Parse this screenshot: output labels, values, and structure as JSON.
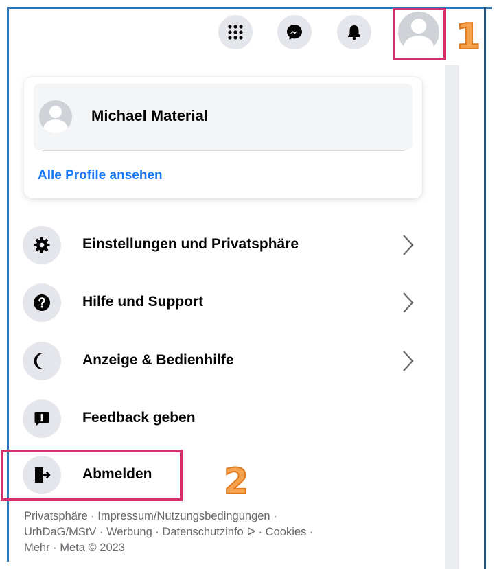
{
  "topbar": {
    "buttons": [
      {
        "icon": "grid-menu-icon"
      },
      {
        "icon": "messenger-icon"
      },
      {
        "icon": "notifications-bell-icon"
      },
      {
        "icon": "account-avatar-icon"
      }
    ]
  },
  "annotations": {
    "step1": "1",
    "step2": "2",
    "highlight_color": "#d62f6e",
    "number_color": "#f4a24d"
  },
  "profile_card": {
    "name": "Michael Material",
    "see_all_profiles": "Alle Profile ansehen"
  },
  "menu": {
    "items": [
      {
        "label": "Einstellungen und Privatsphäre",
        "icon": "gear-icon",
        "has_chevron": true
      },
      {
        "label": "Hilfe und Support",
        "icon": "question-icon",
        "has_chevron": true
      },
      {
        "label": "Anzeige & Bedienhilfe",
        "icon": "moon-icon",
        "has_chevron": true
      },
      {
        "label": "Feedback geben",
        "icon": "feedback-icon",
        "has_chevron": false
      },
      {
        "label": "Abmelden",
        "icon": "logout-icon",
        "has_chevron": false
      }
    ]
  },
  "footer": {
    "line1": "Privatsphäre · Impressum/Nutzungsbedingungen ·",
    "line2": "UrhDaG/MStV · Werbung · Datenschutzinfo ᐅ · Cookies ·",
    "line3": "Mehr · Meta © 2023"
  },
  "colors": {
    "link_blue": "#1877f2",
    "icon_bg": "#e4e6eb",
    "frame_blue": "#2e76b6"
  }
}
